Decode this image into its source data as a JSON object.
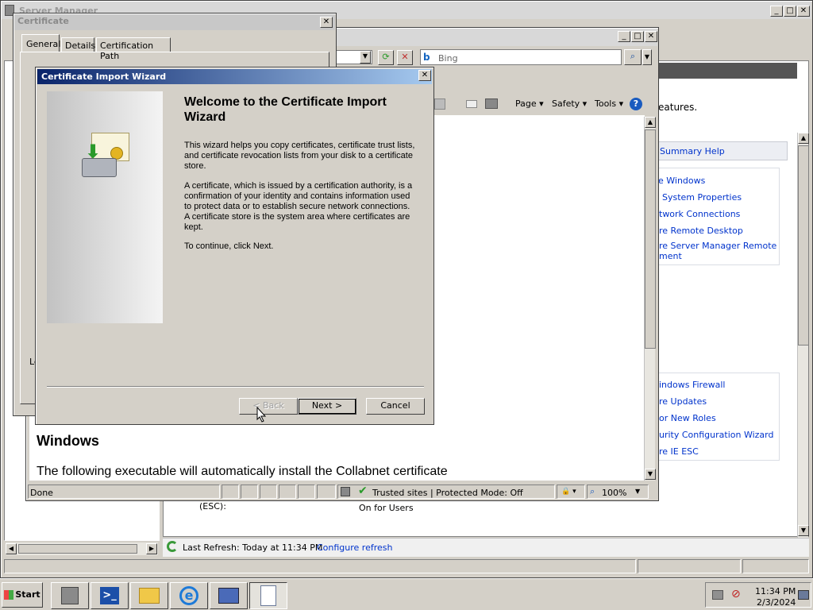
{
  "server_manager": {
    "title": "Server Manager",
    "links_top": [
      "Summary Help"
    ],
    "links_mid": [
      "e Windows",
      "System Properties",
      "twork Connections",
      "re Remote Desktop",
      "re Server Manager Remote",
      "ment"
    ],
    "links_bottom": [
      "indows Firewall",
      "re Updates",
      "or New Roles",
      "urity Configuration Wizard",
      "re IE ESC"
    ],
    "features_text": "eatures.",
    "esc_label": "(ESC):",
    "esc_value": "On for Users",
    "last_refresh": "Last Refresh: Today at 11:34 PM",
    "configure_refresh": "Configure refresh"
  },
  "ie": {
    "search_placeholder": "Bing",
    "toolbar": {
      "page": "Page",
      "safety": "Safety",
      "tools": "Tools"
    },
    "content_heading": "Windows",
    "content_text": "The following executable will automatically install the Collabnet certificate",
    "status": {
      "done": "Done",
      "zone": "Trusted sites | Protected Mode: Off",
      "zoom": "100%"
    }
  },
  "certificate": {
    "title": "Certificate",
    "tabs": [
      "General",
      "Details",
      "Certification Path"
    ],
    "partial_label": "Le"
  },
  "wizard": {
    "title": "Certificate Import Wizard",
    "heading": "Welcome to the Certificate Import Wizard",
    "para1": "This wizard helps you copy certificates, certificate trust lists, and certificate revocation lists from your disk to a certificate store.",
    "para2": "A certificate, which is issued by a certification authority, is a confirmation of your identity and contains information used to protect data or to establish secure network connections. A certificate store is the system area where certificates are kept.",
    "para3": "To continue, click Next.",
    "buttons": {
      "back": "< Back",
      "next": "Next >",
      "cancel": "Cancel"
    }
  },
  "taskbar": {
    "start": "Start",
    "time": "11:34 PM",
    "date": "2/3/2024"
  },
  "colors": {
    "title_active": "#0a246a",
    "link": "#0033cc",
    "face": "#d4d0c8"
  }
}
